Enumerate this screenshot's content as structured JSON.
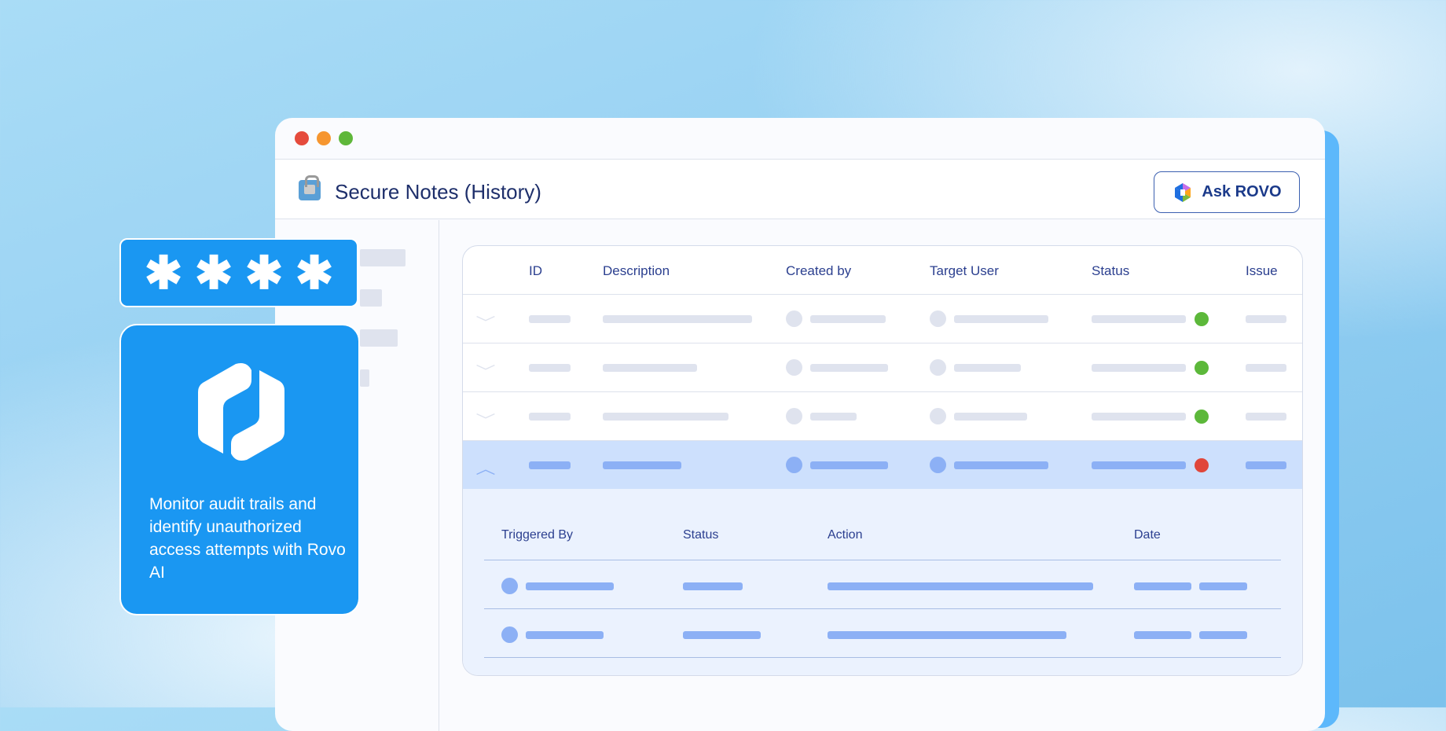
{
  "window": {
    "title": "Secure Notes (History)",
    "ask_button": "Ask ROVO"
  },
  "table": {
    "headers": [
      "ID",
      "Description",
      "Created by",
      "Target User",
      "Status",
      "Issue"
    ],
    "rows": [
      {
        "status_color": "#5cb83a",
        "expanded": false
      },
      {
        "status_color": "#5cb83a",
        "expanded": false
      },
      {
        "status_color": "#5cb83a",
        "expanded": false
      },
      {
        "status_color": "#e0463a",
        "expanded": true
      }
    ]
  },
  "detail": {
    "headers": [
      "Triggered By",
      "Status",
      "Action",
      "Date"
    ]
  },
  "password_card": {
    "mask": [
      "✱",
      "✱",
      "✱",
      "✱"
    ]
  },
  "info_card": {
    "text": "Monitor audit trails and identify unauthorized access attempts with Rovo AI"
  }
}
